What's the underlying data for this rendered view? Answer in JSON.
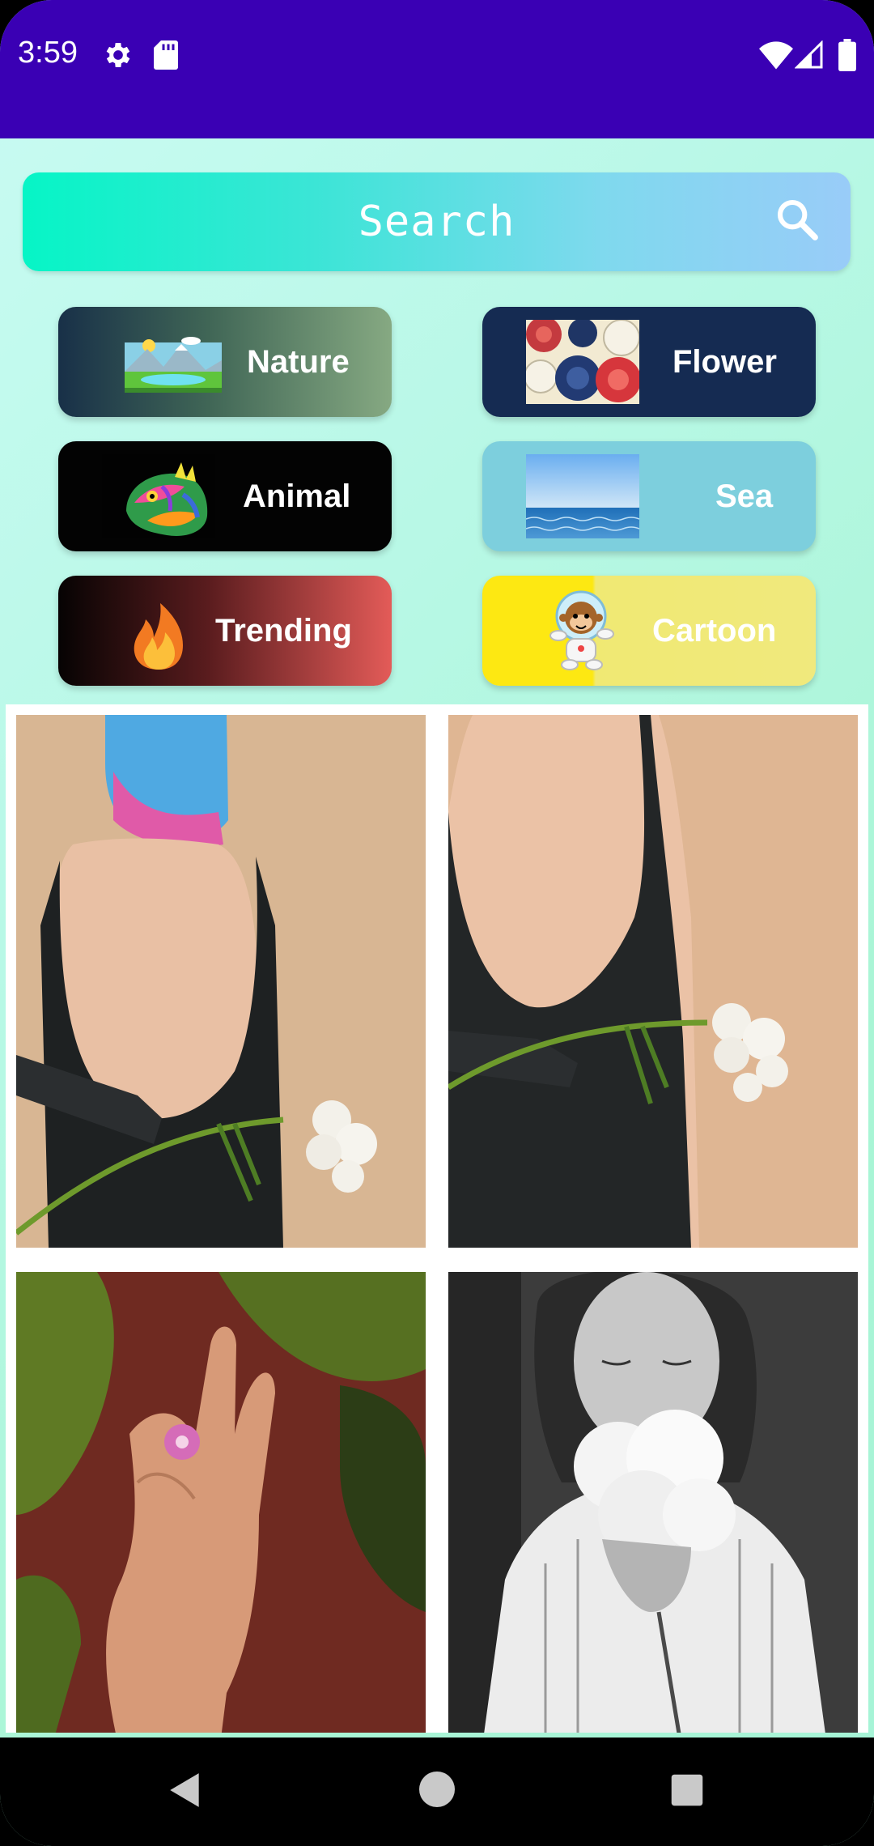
{
  "status_bar": {
    "time": "3:59",
    "icons": [
      "gear-icon",
      "sd-card-icon",
      "wifi-icon",
      "signal-icon",
      "battery-icon"
    ],
    "background": "#3a00b4"
  },
  "search": {
    "label": "Search",
    "icon": "search-icon"
  },
  "categories": [
    {
      "label": "Nature",
      "image": "landscape-thumbnail"
    },
    {
      "label": "Flower",
      "image": "flower-pattern-thumbnail"
    },
    {
      "label": "Animal",
      "image": "iguana-thumbnail"
    },
    {
      "label": "Sea",
      "image": "sea-horizon-thumbnail"
    },
    {
      "label": "Trending",
      "image": "fire-icon"
    },
    {
      "label": "Cartoon",
      "image": "monkey-astronaut-icon"
    }
  ],
  "photos": [
    {
      "subject": "woman-back-with-flower"
    },
    {
      "subject": "woman-back-with-flower-2"
    },
    {
      "subject": "hand-with-pink-flower"
    },
    {
      "subject": "woman-smelling-peony"
    }
  ],
  "nav_bar": {
    "buttons": [
      "back-icon",
      "home-icon",
      "recents-icon"
    ]
  }
}
